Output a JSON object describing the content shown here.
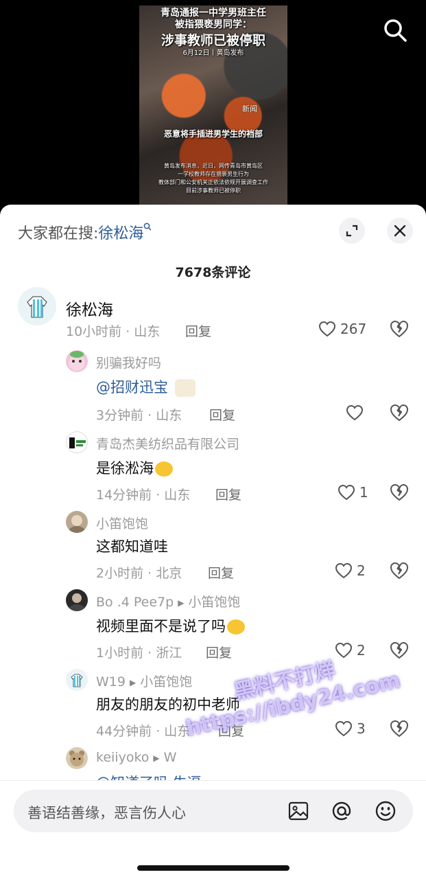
{
  "video": {
    "headline_line1": "青岛通报一中学男班主任",
    "headline_line2": "被指猥亵男同学：",
    "headline_line3": "涉事教师已被停职",
    "date_source": "6月12日丨黄岛发布",
    "brand": "新闻",
    "caption_mid": "恶意将手插进男学生的裆部",
    "caption_small_1": "黄岛发布消息，近日，网传青岛市黄岛区",
    "caption_small_2": "一学校教师存在猥亵男生行为",
    "caption_small_3": "教体部门和公安机关正依法依规开展调查工作",
    "caption_small_4": "目前涉事教师已被停职"
  },
  "sheet": {
    "search_prefix": "大家都在搜:",
    "search_keyword": "徐松海",
    "comment_count": "7678条评论"
  },
  "comments": [
    {
      "name": "",
      "text": "徐松海",
      "time_loc": "10小时前 · 山东",
      "reply": "回复",
      "likes": "267"
    },
    {
      "name": "别骗我好吗",
      "text": "@招财迅宝",
      "time_loc": "3分钟前 · 山东",
      "reply": "回复",
      "likes": ""
    },
    {
      "name": "青岛杰美纺织品有限公司",
      "text": "是徐淞海",
      "time_loc": "14分钟前 · 山东",
      "reply": "回复",
      "likes": "1"
    },
    {
      "name": "小笛饱饱",
      "text": "这都知道哇",
      "time_loc": "2小时前 · 北京",
      "reply": "回复",
      "likes": "2"
    },
    {
      "name": "Bo .4 Pee7p",
      "reply_to": "小笛饱饱",
      "text": "视频里面不是说了吗",
      "time_loc": "1小时前 · 浙江",
      "reply": "回复",
      "likes": "2"
    },
    {
      "name": "W19",
      "reply_to": "小笛饱饱",
      "text": "朋友的朋友的初中老师",
      "time_loc": "44分钟前 · 山东",
      "reply": "回复",
      "likes": "3"
    },
    {
      "name": "keiiyoko",
      "reply_to": "W",
      "text": "@知道了吗 牛逼"
    }
  ],
  "input": {
    "placeholder": "善语结善缘，恶言伤人心"
  },
  "watermark": {
    "line1": "黑料不打烊",
    "line2": "https://ibdy24.com"
  },
  "colors": {
    "link_blue": "#2e5c9a",
    "muted_gray": "#9a9a9a",
    "sheet_bg": "#ffffff"
  },
  "icons": [
    "search-icon",
    "expand-icon",
    "close-icon",
    "heart-icon",
    "broken-heart-icon",
    "image-icon",
    "at-icon",
    "emoji-icon"
  ]
}
